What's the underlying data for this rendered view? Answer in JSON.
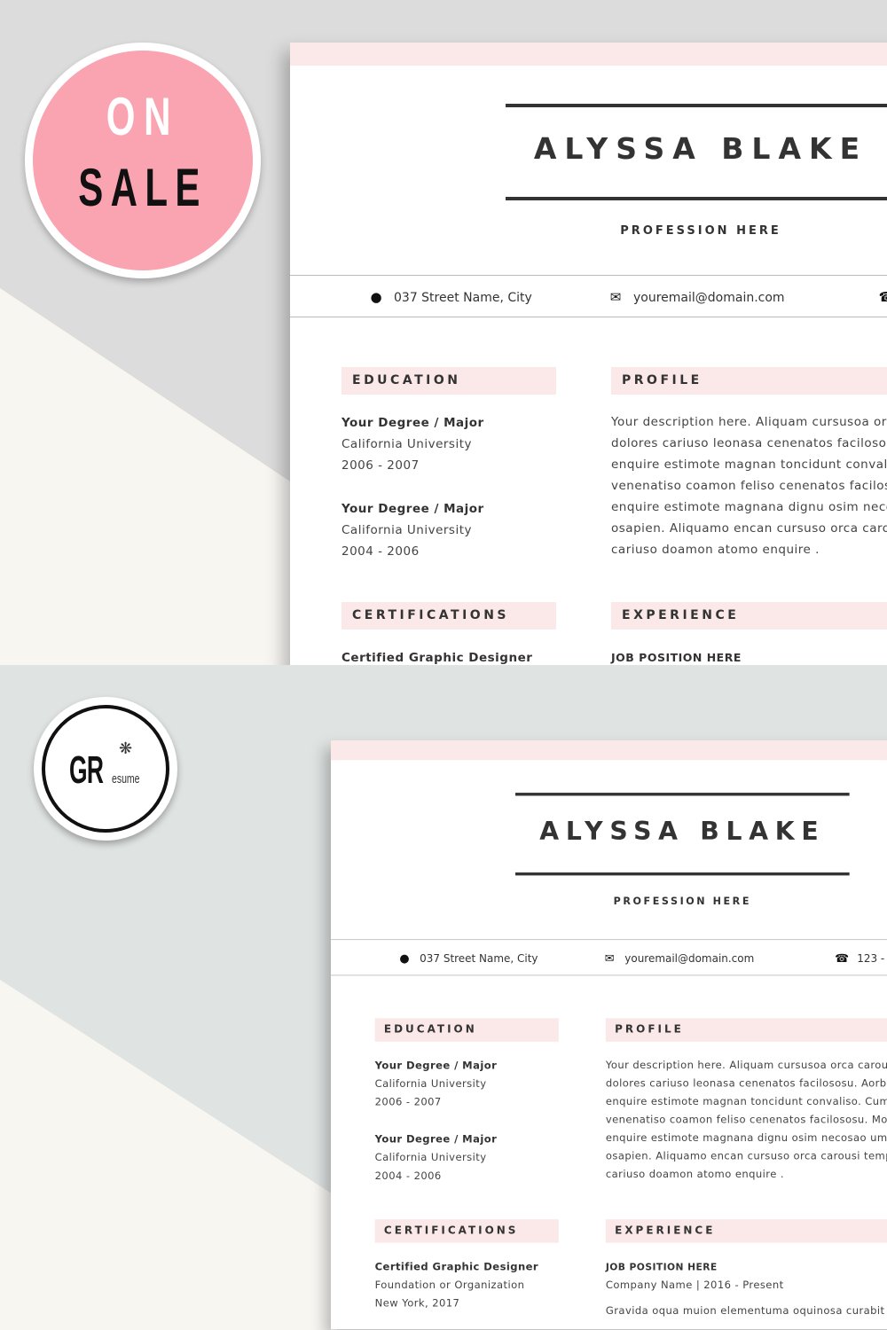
{
  "promo": {
    "badge_line1": "ON",
    "badge_line2": "SALE",
    "badge_color": "#f9a4b0",
    "logo_text": "GR",
    "logo_subtext": "esume"
  },
  "resume": {
    "name": "ALYSSA BLAKE",
    "profession": "PROFESSION HERE",
    "contact": {
      "address": "037  Street Name, City",
      "email": "youremail@domain.com",
      "phone": "123 -"
    },
    "education": {
      "heading": "EDUCATION",
      "items": [
        {
          "degree": "Your Degree / Major",
          "school": "California University",
          "years": "2006 - 2007"
        },
        {
          "degree": "Your Degree / Major",
          "school": "California University",
          "years": "2004 - 2006"
        }
      ]
    },
    "certifications": {
      "heading": "CERTIFICATIONS",
      "items": [
        {
          "title": "Certified  Graphic Designer",
          "org": "Foundation or Organization",
          "place": "New York, 2017"
        }
      ]
    },
    "profile": {
      "heading": "PROFILE",
      "lines": [
        "Your description here. Aliquam cursusoa orca carous",
        "dolores  cariuso  leonasa  cenenatos  facilososu.  Aorb",
        "enquire estimote  magnan toncidunt convaliso. Cum",
        "venenatiso coamon feliso cenenatos facilososu. Mor",
        "enquire estimote  magnana dignu osim necosao um",
        "osapien. Aliquamo encan cursuso orca carousi temp",
        "cariuso doamon atomo enquire ."
      ]
    },
    "experience": {
      "heading": "EXPERIENCE",
      "job": "JOB POSITION HERE",
      "company": "Company Name | 2016 - Present",
      "desc": "Gravida oqua muion elementuma oquinosa curabit"
    },
    "accent_color": "#fbe9e9"
  }
}
